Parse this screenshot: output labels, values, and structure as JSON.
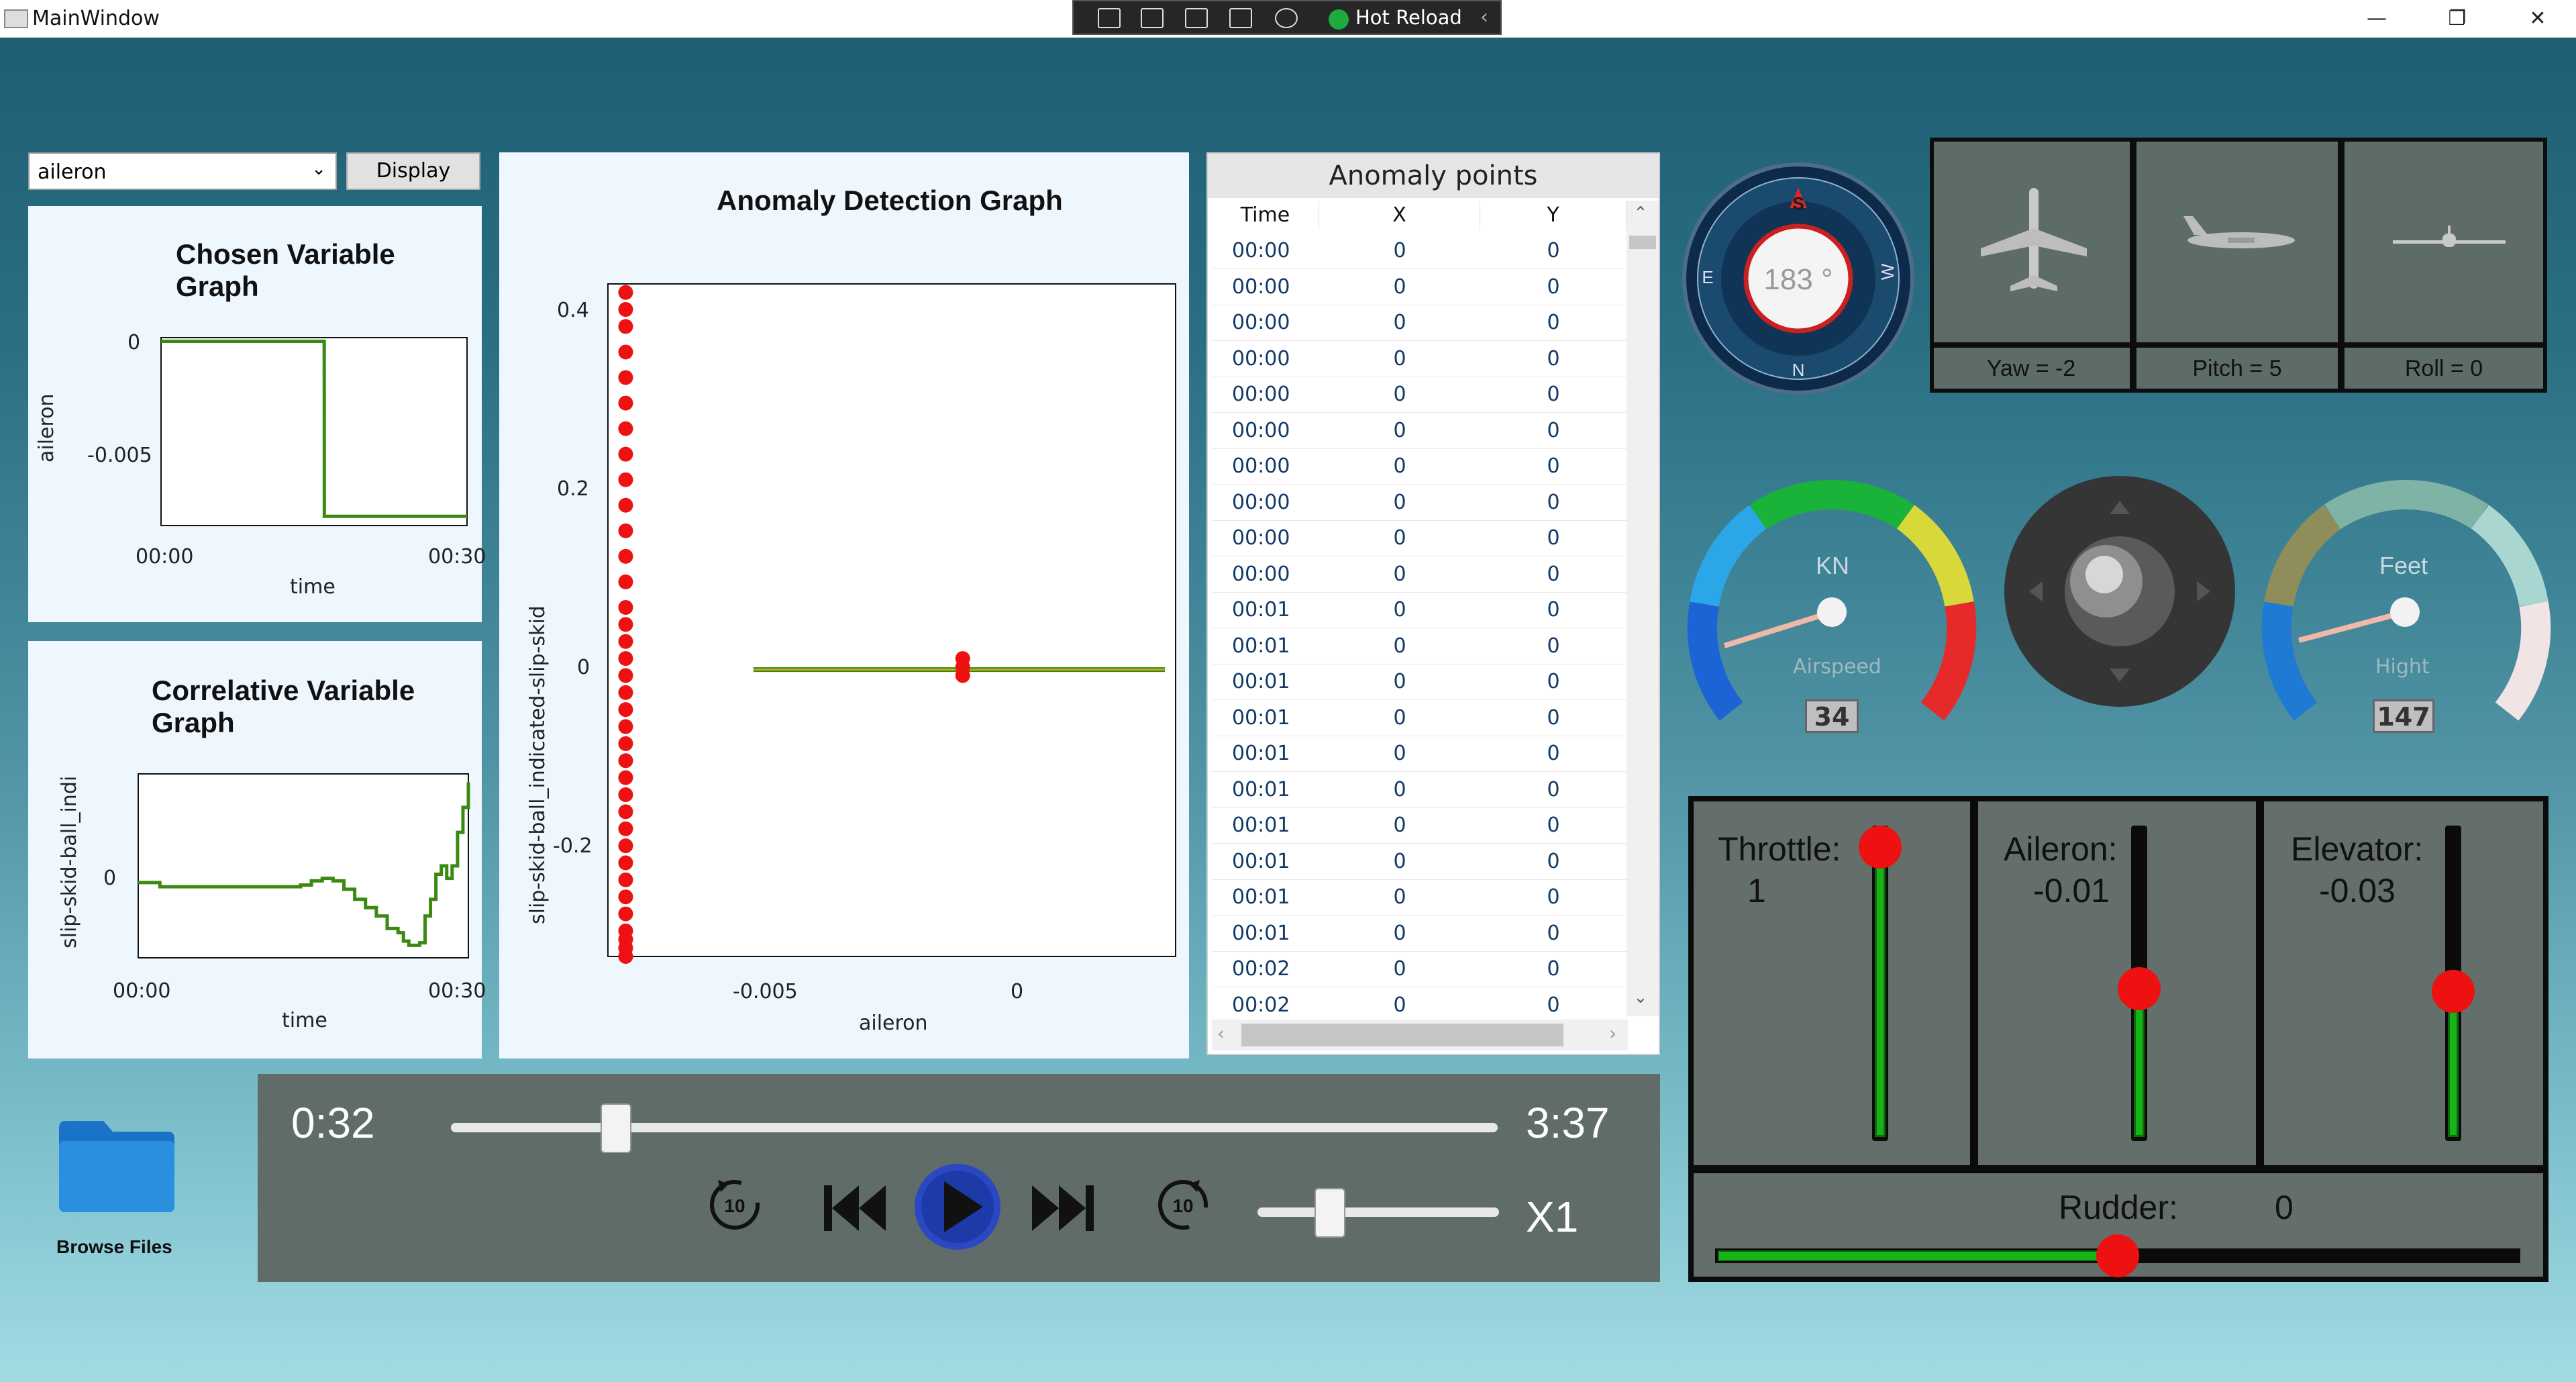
{
  "window": {
    "title": "MainWindow",
    "minimize": "—",
    "restore": "❐",
    "close": "✕"
  },
  "devtools": {
    "hot_reload": "Hot Reload"
  },
  "selector": {
    "value": "aileron",
    "display_label": "Display"
  },
  "chosen_graph": {
    "title": "Chosen Variable Graph",
    "ylabel": "aileron",
    "xlabel": "time",
    "yticks": [
      "0",
      "-0.005"
    ],
    "xticks": [
      "00:00",
      "00:30"
    ]
  },
  "correlative_graph": {
    "title": "Correlative Variable Graph",
    "ylabel": "slip-skid-ball_indi",
    "xlabel": "time",
    "yticks": [
      "0"
    ],
    "xticks": [
      "00:00",
      "00:30"
    ]
  },
  "anomaly_graph": {
    "title": "Anomaly Detection Graph",
    "ylabel": "slip-skid-ball_indicated-slip-skid",
    "xlabel": "aileron",
    "yticks": [
      "0.4",
      "0.2",
      "0",
      "-0.2"
    ],
    "xticks": [
      "-0.005",
      "0"
    ]
  },
  "chart_data": [
    {
      "type": "line",
      "title": "Chosen Variable Graph",
      "xlabel": "time",
      "ylabel": "aileron",
      "x": [
        0,
        16,
        16.01,
        30
      ],
      "values": [
        0,
        0,
        -0.0095,
        -0.0095
      ],
      "ylim": [
        -0.01,
        0.0002
      ],
      "xlim": [
        0,
        30
      ]
    },
    {
      "type": "line",
      "title": "Correlative Variable Graph",
      "xlabel": "time",
      "ylabel": "slip-skid-ball_indi",
      "x": [
        0,
        1.6,
        2,
        4,
        6,
        8,
        10,
        12,
        14,
        15,
        16,
        17,
        18,
        19,
        20,
        21,
        22,
        23,
        24,
        24.5,
        25,
        25.5,
        26,
        26.5,
        27,
        27.5,
        28,
        28.5,
        29,
        29.5,
        30,
        30.5
      ],
      "values": [
        0,
        0,
        -0.0005,
        -0.0005,
        -0.0005,
        -0.0005,
        -0.0005,
        -0.0005,
        -0.0005,
        -0.0003,
        0.0002,
        0.0005,
        0.0002,
        -0.0008,
        -0.002,
        -0.003,
        -0.004,
        -0.0055,
        -0.006,
        -0.007,
        -0.0075,
        -0.0075,
        -0.0072,
        -0.004,
        -0.002,
        0.001,
        0.002,
        0.0005,
        0.002,
        0.006,
        0.009,
        0.012
      ],
      "ylim": [
        -0.009,
        0.013
      ],
      "xlim": [
        0,
        30.5
      ]
    },
    {
      "type": "scatter",
      "title": "Anomaly Detection Graph",
      "xlabel": "aileron",
      "ylabel": "slip-skid-ball_indicated-slip-skid",
      "series": [
        {
          "x": [
            -0.0095,
            -0.0095,
            -0.0095,
            -0.0095,
            -0.0095,
            -0.0095,
            -0.0095,
            -0.0095,
            -0.0095,
            -0.0095,
            -0.0095,
            -0.0095,
            -0.0095,
            -0.0095,
            -0.0095,
            -0.0095,
            -0.0095,
            -0.0095,
            -0.0095,
            -0.0095,
            -0.0095,
            -0.0095,
            -0.0095,
            -0.0095,
            -0.0095,
            -0.0095,
            -0.0095,
            -0.0095,
            -0.0095,
            -0.0095,
            -0.0095,
            -0.0095,
            -0.0095,
            -0.0095,
            -0.0095,
            -0.0095,
            0,
            0,
            0
          ],
          "y": [
            0.43,
            0.41,
            0.39,
            0.36,
            0.33,
            0.3,
            0.27,
            0.24,
            0.21,
            0.18,
            0.15,
            0.12,
            0.09,
            0.06,
            0.04,
            0.02,
            0.0,
            -0.02,
            -0.04,
            -0.06,
            -0.08,
            -0.1,
            -0.12,
            -0.14,
            -0.16,
            -0.18,
            -0.2,
            -0.22,
            -0.24,
            -0.26,
            -0.28,
            -0.3,
            -0.32,
            -0.33,
            -0.34,
            -0.35,
            0.0,
            -0.01,
            -0.02
          ]
        }
      ],
      "regression_line": {
        "x": [
          -0.0059,
          0.0057
        ],
        "y": [
          -0.013,
          -0.013
        ]
      },
      "xlim": [
        -0.01,
        0.006
      ],
      "ylim": [
        -0.35,
        0.44
      ]
    }
  ],
  "anomaly_table": {
    "title": "Anomaly points",
    "headers": [
      "Time",
      "X",
      "Y"
    ],
    "rows": [
      [
        "00:00",
        "0",
        "0"
      ],
      [
        "00:00",
        "0",
        "0"
      ],
      [
        "00:00",
        "0",
        "0"
      ],
      [
        "00:00",
        "0",
        "0"
      ],
      [
        "00:00",
        "0",
        "0"
      ],
      [
        "00:00",
        "0",
        "0"
      ],
      [
        "00:00",
        "0",
        "0"
      ],
      [
        "00:00",
        "0",
        "0"
      ],
      [
        "00:00",
        "0",
        "0"
      ],
      [
        "00:00",
        "0",
        "0"
      ],
      [
        "00:01",
        "0",
        "0"
      ],
      [
        "00:01",
        "0",
        "0"
      ],
      [
        "00:01",
        "0",
        "0"
      ],
      [
        "00:01",
        "0",
        "0"
      ],
      [
        "00:01",
        "0",
        "0"
      ],
      [
        "00:01",
        "0",
        "0"
      ],
      [
        "00:01",
        "0",
        "0"
      ],
      [
        "00:01",
        "0",
        "0"
      ],
      [
        "00:01",
        "0",
        "0"
      ],
      [
        "00:01",
        "0",
        "0"
      ],
      [
        "00:02",
        "0",
        "0"
      ],
      [
        "00:02",
        "0",
        "0"
      ]
    ]
  },
  "compass": {
    "heading": "183 °"
  },
  "attitude": {
    "yaw": "Yaw = -2",
    "pitch": "Pitch = 5",
    "roll": "Roll = 0"
  },
  "airspeed": {
    "unit": "KN",
    "label": "Airspeed",
    "value": "34",
    "ticks": [
      "50",
      "100",
      "150",
      "200",
      "250",
      "300",
      "0"
    ]
  },
  "altimeter": {
    "unit": "Feet",
    "label": "Hight",
    "value": "147"
  },
  "controls": {
    "throttle_label": "Throttle:",
    "throttle_value": "1",
    "throttle_level": 1.0,
    "aileron_label": "Aileron:",
    "aileron_value": "-0.01",
    "aileron_level": 0.48,
    "elevator_label": "Elevator:",
    "elevator_value": "-0.03",
    "elevator_level": 0.47,
    "rudder_label": "Rudder:",
    "rudder_value": "0",
    "rudder_level": 0.5
  },
  "player": {
    "current_time": "0:32",
    "total_time": "3:37",
    "speed": "X1",
    "progress": 0.147,
    "speed_level": 0.27,
    "back10": "10",
    "fwd10": "10"
  },
  "browse": {
    "label": "Browse Files"
  },
  "colors": {
    "accent_red": "#ee1111",
    "line_green": "#3a8a12",
    "fill_green": "#18b318"
  }
}
